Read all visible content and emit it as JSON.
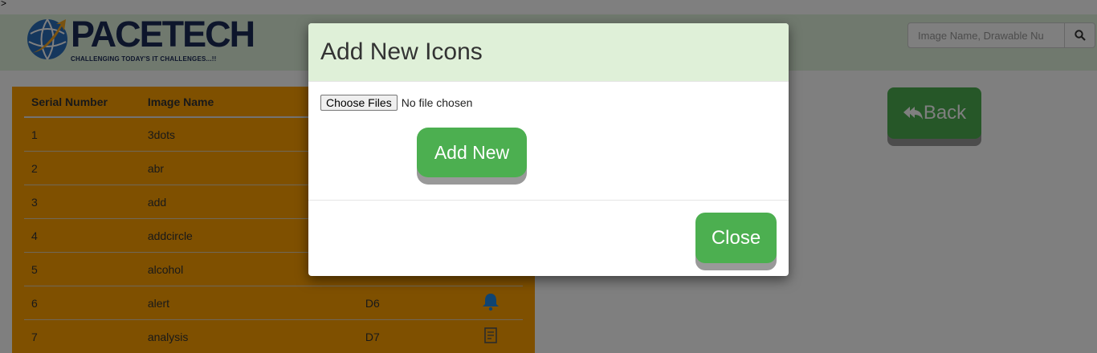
{
  "page": {
    "corner_text": ">"
  },
  "header": {
    "logo_text": "PACETECH",
    "tagline": "CHALLENGING TODAY'S IT CHALLENGES...!!",
    "search_placeholder": "Image Name, Drawable Nu"
  },
  "table": {
    "headers": [
      "Serial Number",
      "Image Name",
      "",
      ""
    ],
    "rows": [
      {
        "serial": "1",
        "name": "3dots",
        "drawable": "",
        "icon": ""
      },
      {
        "serial": "2",
        "name": "abr",
        "drawable": "",
        "icon": ""
      },
      {
        "serial": "3",
        "name": "add",
        "drawable": "",
        "icon": ""
      },
      {
        "serial": "4",
        "name": "addcircle",
        "drawable": "",
        "icon": ""
      },
      {
        "serial": "5",
        "name": "alcohol",
        "drawable": "",
        "icon": "alcohol-icon"
      },
      {
        "serial": "6",
        "name": "alert",
        "drawable": "D6",
        "icon": "bell-icon"
      },
      {
        "serial": "7",
        "name": "analysis",
        "drawable": "D7",
        "icon": "report-icon"
      }
    ]
  },
  "back_button": {
    "label": "Back"
  },
  "modal": {
    "title": "Add New Icons",
    "choose_files_label": "Choose Files",
    "file_status": "No file chosen",
    "add_button_label": "Add New",
    "close_button_label": "Close"
  },
  "colors": {
    "header_bg": "#e1f2dc",
    "table_bg": "#ffa000",
    "button_green": "#4caf50",
    "modal_header_bg": "#dff0d8",
    "icon_blue": "#1e88e5"
  }
}
